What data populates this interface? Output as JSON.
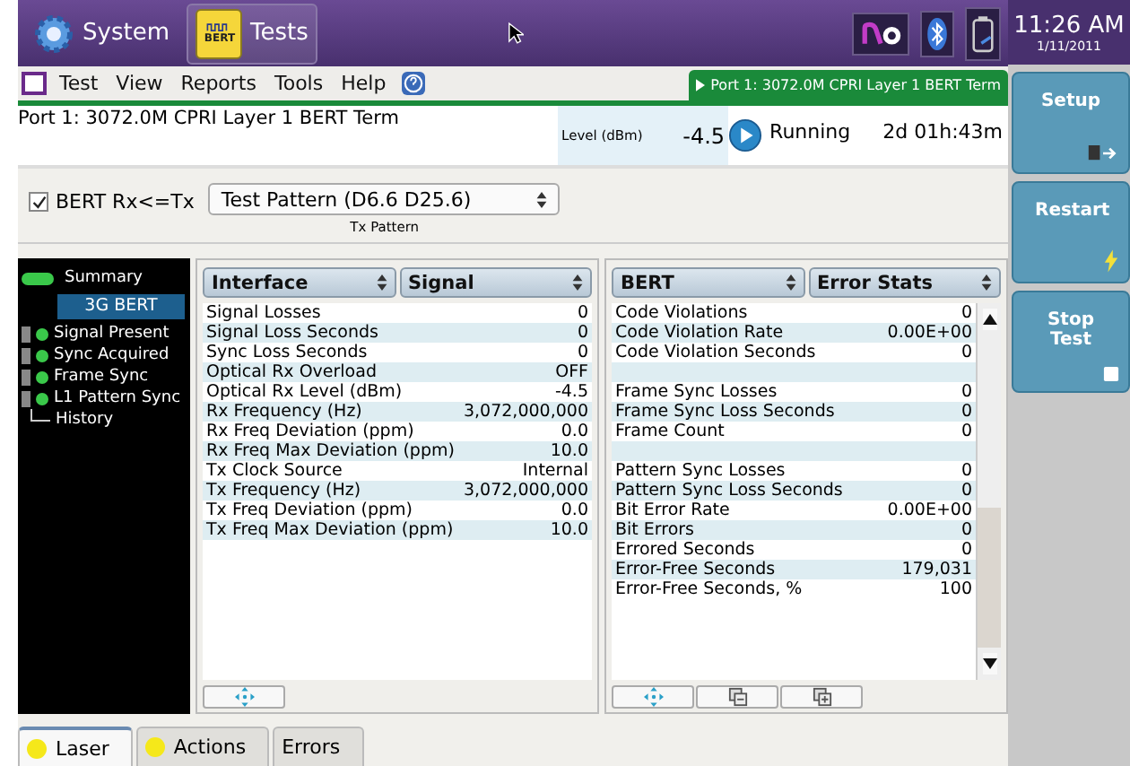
{
  "top_bar": {
    "system_label": "System",
    "tests_label": "Tests",
    "tests_badge": "BERT",
    "time": "11:26 AM",
    "date": "1/11/2011"
  },
  "menu": {
    "items": [
      {
        "label": "Test"
      },
      {
        "label": "View"
      },
      {
        "label": "Reports"
      },
      {
        "label": "Tools"
      },
      {
        "label": "Help"
      }
    ],
    "port_tab": "Port 1: 3072.0M CPRI Layer 1 BERT Term"
  },
  "status": {
    "title": "Port 1: 3072.0M CPRI Layer 1 BERT Term",
    "level_label": "Level (dBm)",
    "level_value": "-4.5",
    "state": "Running",
    "elapsed": "2d 01h:43m"
  },
  "config": {
    "checkbox": {
      "label": "BERT Rx<=Tx",
      "checked": true
    },
    "pattern_select": {
      "value": "Test Pattern (D6.6 D25.6)",
      "caption": "Tx Pattern"
    }
  },
  "sidebar": {
    "items": [
      {
        "kind": "summary",
        "label": "Summary"
      },
      {
        "kind": "header",
        "label": "3G BERT",
        "selected": true
      },
      {
        "kind": "led",
        "label": "Signal Present"
      },
      {
        "kind": "led",
        "label": "Sync Acquired"
      },
      {
        "kind": "led",
        "label": "Frame Sync"
      },
      {
        "kind": "led",
        "label": "L1 Pattern Sync"
      },
      {
        "kind": "plain",
        "label": "History"
      }
    ]
  },
  "panels": [
    {
      "selector_1": "Interface",
      "selector_2": "Signal",
      "scrollbar": false,
      "footer_buttons": [
        {
          "kind": "move"
        }
      ],
      "rows": [
        {
          "kind": "stat",
          "label": "Signal Losses",
          "value": "0"
        },
        {
          "kind": "stat",
          "label": "Signal Loss Seconds",
          "value": "0"
        },
        {
          "kind": "stat",
          "label": "Sync Loss Seconds",
          "value": "0"
        },
        {
          "kind": "stat",
          "label": "Optical Rx Overload",
          "value": "OFF"
        },
        {
          "kind": "stat",
          "label": "Optical Rx Level (dBm)",
          "value": "-4.5"
        },
        {
          "kind": "stat",
          "label": "Rx Frequency (Hz)",
          "value": "3,072,000,000"
        },
        {
          "kind": "stat",
          "label": "Rx Freq Deviation (ppm)",
          "value": "0.0"
        },
        {
          "kind": "stat",
          "label": "Rx Freq Max Deviation (ppm)",
          "value": "10.0"
        },
        {
          "kind": "stat",
          "label": "Tx Clock Source",
          "value": "Internal"
        },
        {
          "kind": "stat",
          "label": "Tx Frequency (Hz)",
          "value": "3,072,000,000"
        },
        {
          "kind": "stat",
          "label": "Tx Freq Deviation (ppm)",
          "value": "0.0"
        },
        {
          "kind": "stat",
          "label": "Tx Freq Max Deviation (ppm)",
          "value": "10.0"
        }
      ]
    },
    {
      "selector_1": "BERT",
      "selector_2": "Error Stats",
      "scrollbar": true,
      "footer_buttons": [
        {
          "kind": "move"
        },
        {
          "kind": "collapse"
        },
        {
          "kind": "expand"
        }
      ],
      "rows": [
        {
          "kind": "stat",
          "label": "Code Violations",
          "value": "0"
        },
        {
          "kind": "stat",
          "label": "Code Violation Rate",
          "value": "0.00E+00"
        },
        {
          "kind": "stat",
          "label": "Code Violation Seconds",
          "value": "0"
        },
        {
          "kind": "spacer"
        },
        {
          "kind": "stat",
          "label": "Frame Sync Losses",
          "value": "0"
        },
        {
          "kind": "stat",
          "label": "Frame Sync Loss Seconds",
          "value": "0"
        },
        {
          "kind": "stat",
          "label": "Frame Count",
          "value": "0"
        },
        {
          "kind": "spacer"
        },
        {
          "kind": "stat",
          "label": "Pattern Sync Losses",
          "value": "0"
        },
        {
          "kind": "stat",
          "label": "Pattern Sync Loss Seconds",
          "value": "0"
        },
        {
          "kind": "stat",
          "label": "Bit Error Rate",
          "value": "0.00E+00"
        },
        {
          "kind": "stat",
          "label": "Bit Errors",
          "value": "0"
        },
        {
          "kind": "stat",
          "label": "Errored Seconds",
          "value": "0"
        },
        {
          "kind": "stat",
          "label": "Error-Free Seconds",
          "value": "179,031"
        },
        {
          "kind": "stat",
          "label": "Error-Free Seconds, %",
          "value": "100"
        }
      ]
    }
  ],
  "bottom_tabs": [
    {
      "label": "Laser",
      "led": true,
      "selected": true
    },
    {
      "label": "Actions",
      "led": true,
      "selected": false
    },
    {
      "label": "Errors",
      "led": false,
      "selected": false
    }
  ],
  "side_buttons": [
    {
      "label": "Setup"
    },
    {
      "label": "Restart"
    },
    {
      "label": "Stop Test"
    }
  ]
}
